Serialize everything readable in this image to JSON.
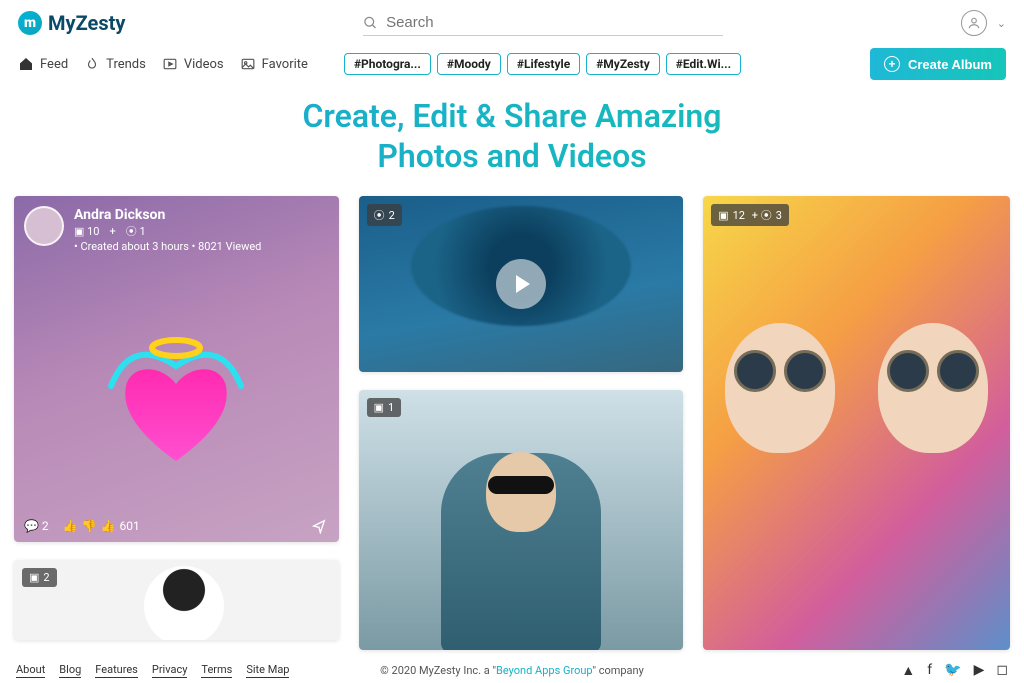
{
  "brand": {
    "name": "MyZesty"
  },
  "search": {
    "placeholder": "Search"
  },
  "nav": {
    "feed": "Feed",
    "trends": "Trends",
    "videos": "Videos",
    "favorite": "Favorite"
  },
  "tags": [
    "#Photogra...",
    "#Moody",
    "#Lifestyle",
    "#MyZesty",
    "#Edit.Wi..."
  ],
  "create_label": "Create Album",
  "hero": {
    "line1": "Create, Edit & Share Amazing",
    "line2": "Photos and Videos"
  },
  "post": {
    "author": "Andra Dickson",
    "photos_count": "10",
    "videos_count": "1",
    "meta": "• Created about 3 hours • 8021 Viewed",
    "comments": "2",
    "likes": "601"
  },
  "badges": {
    "small": "2",
    "video": "2",
    "man": "1",
    "duo_photos": "12",
    "duo_videos": "3"
  },
  "footer": {
    "links": [
      "About",
      "Blog",
      "Features",
      "Privacy",
      "Terms",
      "Site Map"
    ],
    "copy_prefix": "© 2020 MyZesty Inc. a \"",
    "copy_group": "Beyond Apps Group",
    "copy_suffix": "\" company"
  }
}
